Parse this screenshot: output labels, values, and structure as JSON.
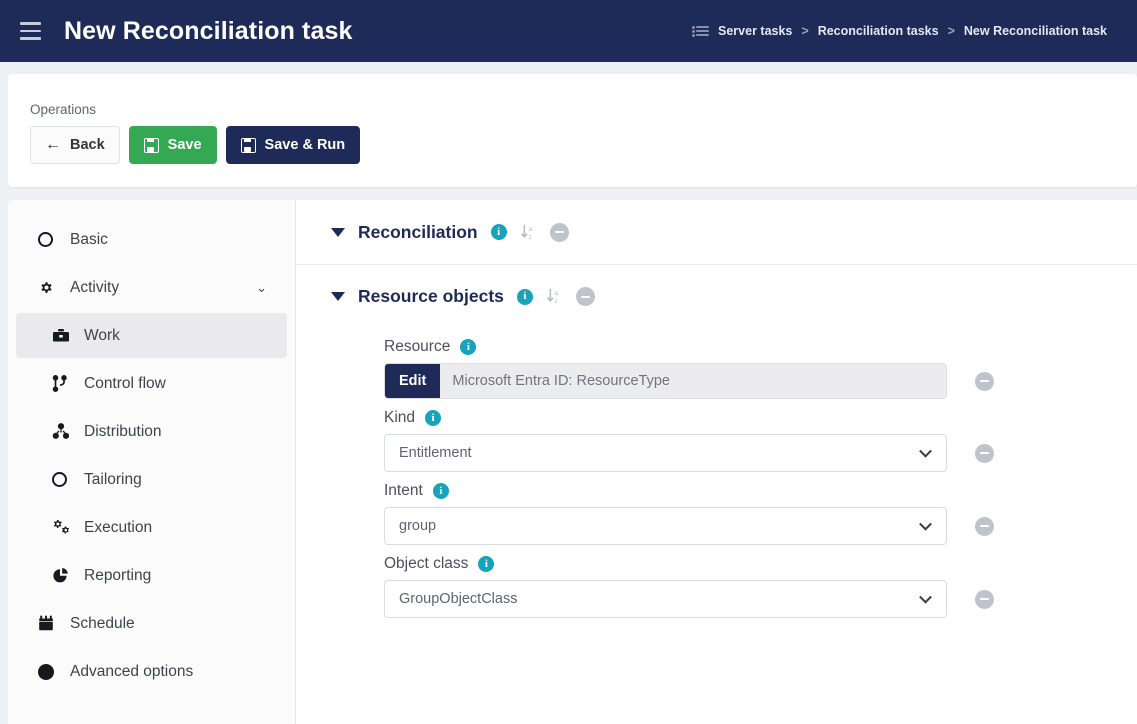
{
  "header": {
    "menu_icon": "hamburger-icon",
    "title": "New Reconciliation task",
    "breadcrumb_icon": "task-list-icon",
    "breadcrumb": [
      {
        "label": "Server tasks",
        "sep": ">"
      },
      {
        "label": "Reconciliation tasks",
        "sep": ">"
      },
      {
        "label": "New Reconciliation task",
        "sep": ""
      }
    ]
  },
  "operations": {
    "label": "Operations",
    "back_label": "Back",
    "back_icon": "arrow-left-icon",
    "save_label": "Save",
    "save_icon": "floppy-disk-icon",
    "save_run_label": "Save & Run",
    "save_run_icon": "floppy-disk-icon",
    "save_color": "#34a853",
    "save_run_color": "#1e2a57"
  },
  "sidebar": {
    "items": [
      {
        "label": "Basic",
        "icon": "circle-icon",
        "level": 0,
        "active": false,
        "chevron": ""
      },
      {
        "label": "Activity",
        "icon": "gear-icon",
        "level": 0,
        "active": false,
        "chevron": "⌄"
      },
      {
        "label": "Work",
        "icon": "briefcase-icon",
        "level": 1,
        "active": true,
        "chevron": ""
      },
      {
        "label": "Control flow",
        "icon": "branch-icon",
        "level": 1,
        "active": false,
        "chevron": ""
      },
      {
        "label": "Distribution",
        "icon": "nodes-icon",
        "level": 1,
        "active": false,
        "chevron": ""
      },
      {
        "label": "Tailoring",
        "icon": "circle-icon",
        "level": 1,
        "active": false,
        "chevron": ""
      },
      {
        "label": "Execution",
        "icon": "gears-icon",
        "level": 1,
        "active": false,
        "chevron": ""
      },
      {
        "label": "Reporting",
        "icon": "pie-chart-icon",
        "level": 1,
        "active": false,
        "chevron": ""
      },
      {
        "label": "Schedule",
        "icon": "calendar-icon",
        "level": 0,
        "active": false,
        "chevron": ""
      },
      {
        "label": "Advanced options",
        "icon": "filled-circle-icon",
        "level": 0,
        "active": false,
        "chevron": ""
      }
    ]
  },
  "content": {
    "sections": [
      {
        "title": "Reconciliation",
        "info_icon": "info-icon",
        "sort_icon": "sort-alpha-down-icon",
        "remove_icon": "minus-circle-icon"
      },
      {
        "title": "Resource objects",
        "info_icon": "info-icon",
        "sort_icon": "sort-alpha-down-icon",
        "remove_icon": "minus-circle-icon"
      }
    ],
    "fields": [
      {
        "label": "Resource",
        "info_icon": "info-icon",
        "type": "edit-readonly",
        "button_label": "Edit",
        "value": "Microsoft Entra ID: ResourceType",
        "remove_icon": "minus-circle-icon"
      },
      {
        "label": "Kind",
        "info_icon": "info-icon",
        "type": "select",
        "value": "Entitlement",
        "remove_icon": "minus-circle-icon"
      },
      {
        "label": "Intent",
        "info_icon": "info-icon",
        "type": "select",
        "value": "group",
        "remove_icon": "minus-circle-icon"
      },
      {
        "label": "Object class",
        "info_icon": "info-icon",
        "type": "select",
        "value": "GroupObjectClass",
        "remove_icon": "minus-circle-icon"
      }
    ]
  },
  "colors": {
    "brand_navy": "#1e2a57",
    "accent_green": "#34a853",
    "info_teal": "#17a3bb",
    "page_bg": "#eef0f4"
  }
}
